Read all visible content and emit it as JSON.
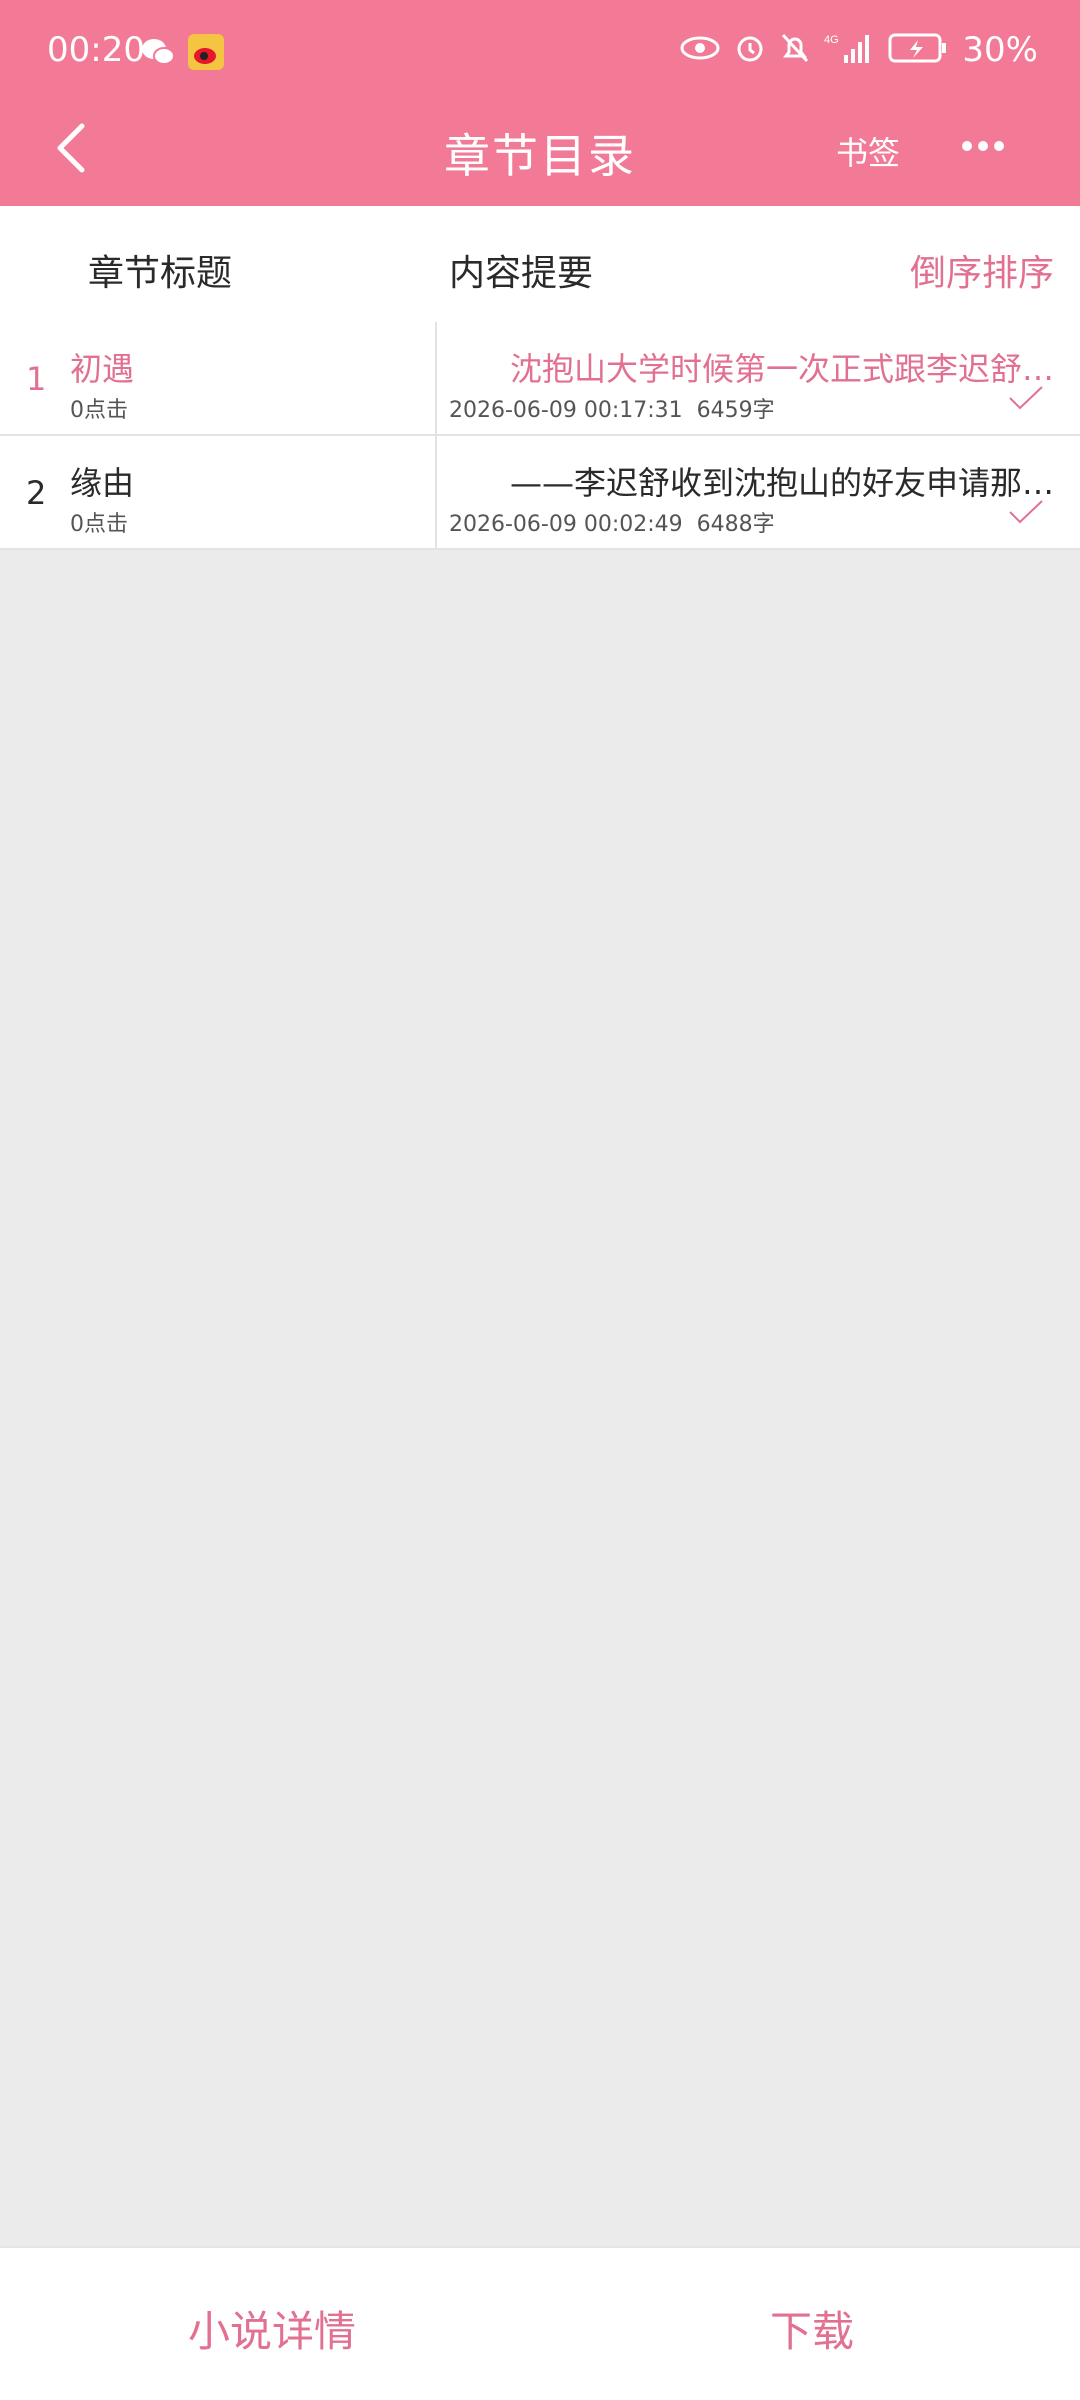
{
  "status_bar": {
    "time": "00:20",
    "left_icons": [
      "wechat-icon",
      "weibo-icon"
    ],
    "right_icons": [
      "eye-icon",
      "alarm-icon",
      "mute-icon",
      "signal-4g-icon",
      "battery-charging-icon"
    ],
    "battery": "30%"
  },
  "title_bar": {
    "title": "章节目录",
    "bookmark_label": "书签"
  },
  "columns": {
    "chapter_title": "章节标题",
    "summary": "内容提要",
    "sort": "倒序排序"
  },
  "chapters": [
    {
      "index": "1",
      "title": "初遇",
      "clicks": "0点击",
      "summary": "沈抱山大学时候第一次正式跟李迟舒见…",
      "time": "2026-06-09 00:17:31",
      "words": "6459字",
      "active": true
    },
    {
      "index": "2",
      "title": "缘由",
      "clicks": "0点击",
      "summary": "——李迟舒收到沈抱山的好友申请那会…",
      "time": "2026-06-09 00:02:49",
      "words": "6488字",
      "active": false
    }
  ],
  "bottom_bar": {
    "details_label": "小说详情",
    "download_label": "下载"
  },
  "colors": {
    "header": "#f27a96",
    "accent": "#e27090",
    "background": "#ebebeb"
  }
}
